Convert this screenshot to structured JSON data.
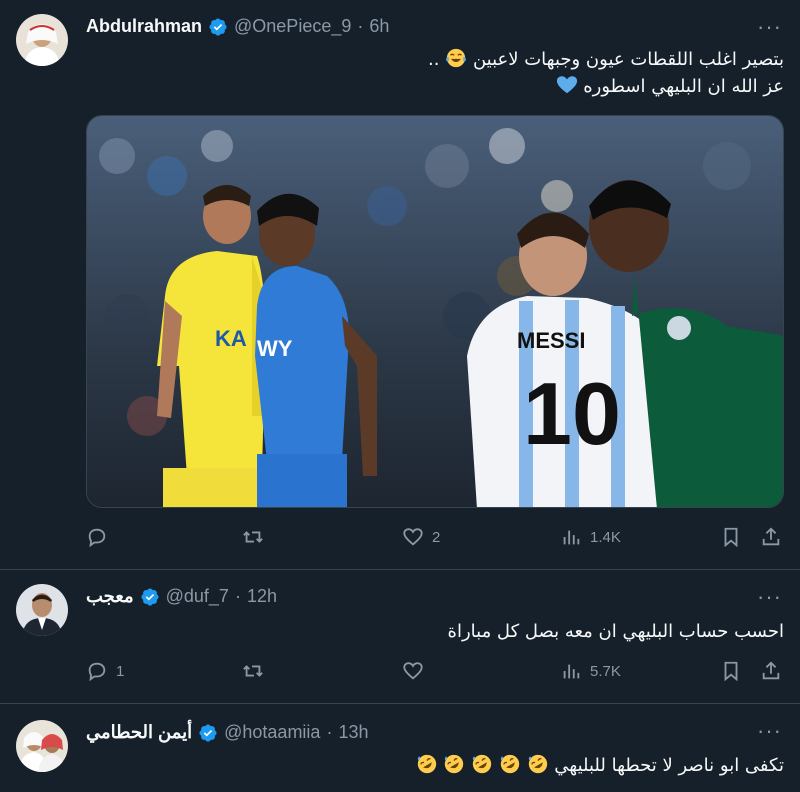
{
  "tweets": [
    {
      "author_name": "Abdulrahman",
      "handle": "@OnePiece_9",
      "time": "6h",
      "text_line1": "بتصير اغلب اللقطات عيون وجبهات لاعبين",
      "text_line1_suffix": " ..",
      "text_line2": "عز الله ان البليهي اسطوره",
      "media": {
        "left_shirt_text": "KA",
        "center_shirt_text": "WY",
        "right_shirt_name": "MESSI",
        "right_shirt_number": "10"
      },
      "stats": {
        "replies": "",
        "retweets": "",
        "likes": "2",
        "views": "1.4K"
      }
    },
    {
      "author_name": "معجب",
      "handle": "@duf_7",
      "time": "12h",
      "text_line1": "احسب حساب البليهي ان معه بصل كل مباراة",
      "stats": {
        "replies": "1",
        "retweets": "",
        "likes": "",
        "views": "5.7K"
      }
    },
    {
      "author_name": "أيمن الحطامي",
      "handle": "@hotaamiia",
      "time": "13h",
      "text_line1": "تكفى ابو ناصر لا تحطها للبليهي"
    }
  ],
  "more_icon": "···",
  "colors": {
    "verified": "#1d9bf0",
    "secondary_text": "#8b98a5",
    "background": "#15202b"
  }
}
